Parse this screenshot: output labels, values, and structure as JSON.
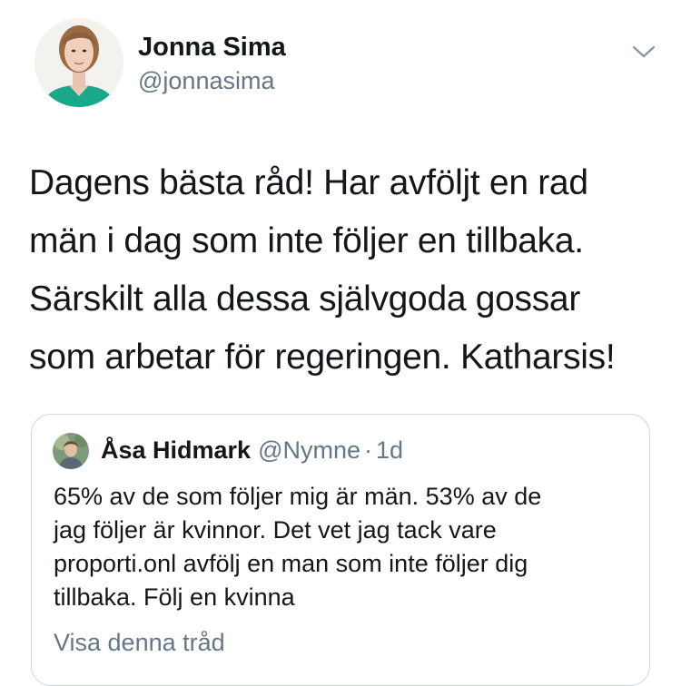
{
  "author": {
    "name": "Jonna Sima",
    "handle": "@jonnasima",
    "avatar_icon": "profile-photo"
  },
  "menu": {
    "icon": "chevron-down-icon"
  },
  "tweet": {
    "lines": [
      "Dagens bästa råd! Har avföljt en rad",
      "män i dag som inte följer en tillbaka.",
      "Särskilt alla dessa självgoda gossar",
      "som arbetar för regeringen. Katharsis!"
    ]
  },
  "quoted": {
    "name": "Åsa Hidmark",
    "handle": "@Nymne",
    "separator": "·",
    "time": "1d",
    "lines": [
      "65% av de som följer mig är män. 53% av de",
      "jag följer är kvinnor. Det vet jag tack vare",
      "proporti.onl avfölj en man som inte följer dig",
      "tillbaka. Följ en kvinna"
    ],
    "thread_link": "Visa denna tråd"
  },
  "colors": {
    "text": "#14171a",
    "secondary": "#657786",
    "border": "#ccd6dd",
    "avatar_shirt": "#17a589"
  }
}
